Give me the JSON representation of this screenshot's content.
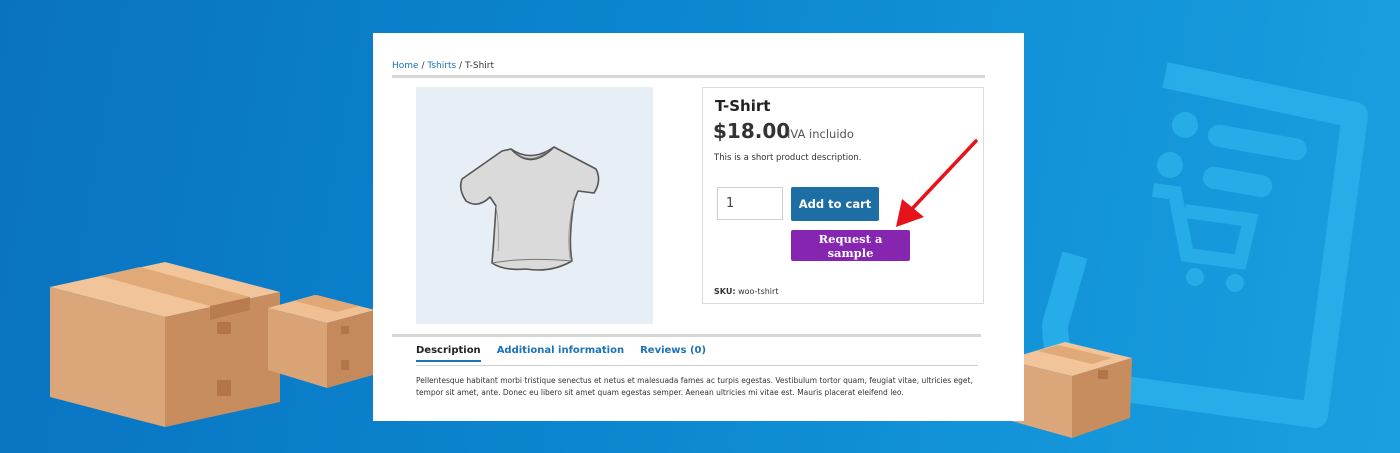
{
  "breadcrumb": {
    "home": "Home",
    "sep1": " / ",
    "category": "Tshirts",
    "sep2": " / ",
    "current": "T-Shirt"
  },
  "product": {
    "title": "T-Shirt",
    "price": "$18.00",
    "tax_note": "IVA incluido",
    "short_description": "This is a short product description.",
    "quantity": "1",
    "add_to_cart_label": "Add to cart",
    "request_sample_label": "Request a sample",
    "sku_label": "SKU:",
    "sku_value": "woo-tshirt"
  },
  "tabs": [
    {
      "label": "Description",
      "active": true
    },
    {
      "label": "Additional information",
      "active": false
    },
    {
      "label": "Reviews (0)",
      "active": false
    }
  ],
  "description_text": "Pellentesque habitant morbi tristique senectus et netus et malesuada fames ac turpis egestas. Vestibulum tortor quam, feugiat vitae, ultricies eget, tempor sit amet, ante. Donec eu libero sit amet quam egestas semper. Aenean ultricies mi vitae est. Mauris placerat eleifend leo.",
  "colors": {
    "background": "#0b86d0",
    "cart_button": "#1c6ea4",
    "sample_button": "#8626b0",
    "arrow": "#e8121a",
    "link": "#1a73b8"
  },
  "icons": [
    "tshirt-image",
    "cardboard-box",
    "phone-receipt-cart-icon",
    "red-arrow-pointer"
  ]
}
